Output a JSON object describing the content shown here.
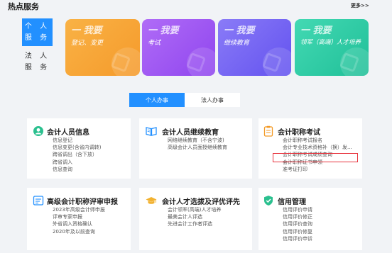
{
  "header": {
    "title": "热点服务",
    "more": "更多>>"
  },
  "side": {
    "personal": "个 人\n服 务",
    "legal": "法 人\n服 务"
  },
  "cards": [
    {
      "big": "一 我要",
      "sub": "登记、变更",
      "color": "#f7a536",
      "color2": "#fbb847"
    },
    {
      "big": "一 我要",
      "sub": "考试",
      "color": "#9b4ff0",
      "color2": "#b266f5"
    },
    {
      "big": "一 我要",
      "sub": "继续教育",
      "color": "#6f5ff0",
      "color2": "#8a78f6"
    },
    {
      "big": "一 我要",
      "sub": "领军（高端）人才培养",
      "color": "#27c7a0",
      "color2": "#3fd6b0"
    }
  ],
  "tabs": {
    "personal": "个人办事",
    "legal": "法人办事"
  },
  "panels": {
    "acct": {
      "title": "会计人员信息",
      "links": [
        "信息登记",
        "信息变更(含省内调转)",
        "跨省调出（含下放）",
        "跨省调入",
        "信息查询"
      ]
    },
    "edu": {
      "title": "会计人员继续教育",
      "links": [
        "网络继续教育（不含宁波)",
        "高级会计人员面授继续教育"
      ]
    },
    "exam": {
      "title": "会计职称考试",
      "links": [
        "会计职称考试报名",
        "会计专业技术资格补（换）发...",
        "会计职称考试成绩查询",
        "会计职称证书申领",
        "准考证打印"
      ]
    },
    "senior": {
      "title": "高级会计职称评审申报",
      "links": [
        "2023年高级会计师申报",
        "评审专家申报",
        "外省调入资格确认",
        "2020年及以前查询"
      ]
    },
    "talent": {
      "title": "会计人才选拔及评优评先",
      "links": [
        "会计领军(高端)人才培养",
        "最美会计人评选",
        "先进会计工作者评选"
      ]
    },
    "credit": {
      "title": "信用管理",
      "links": [
        "信用评价申请",
        "信用评价修正",
        "信用评价查询",
        "信用评价修复",
        "信用评价申诉"
      ]
    }
  }
}
